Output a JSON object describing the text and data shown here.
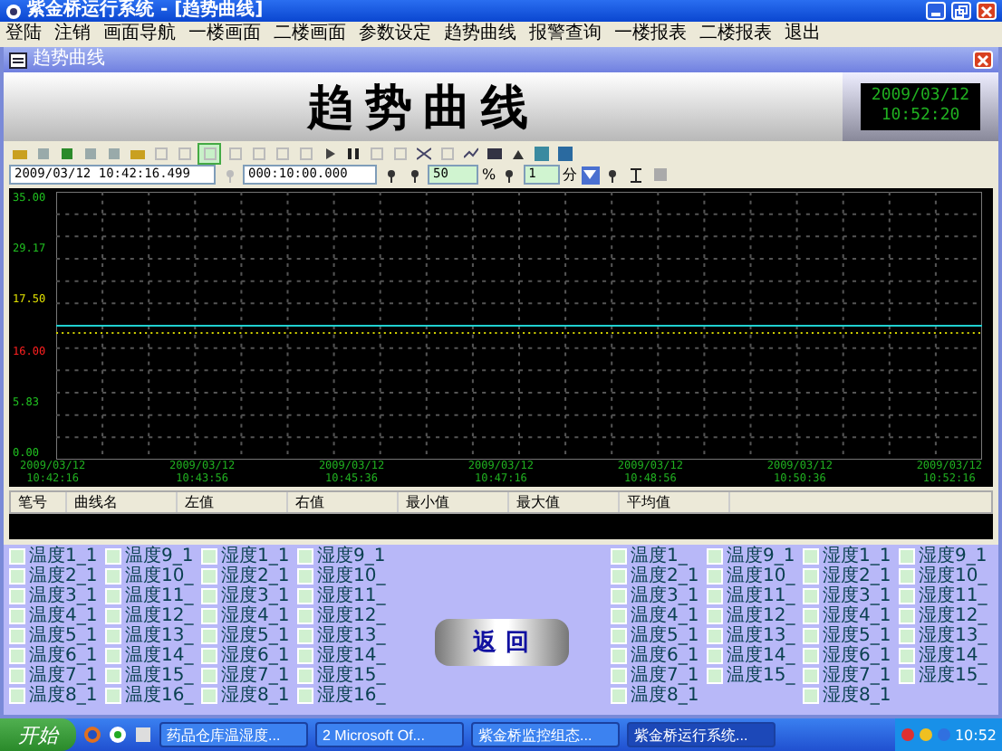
{
  "window": {
    "title": "紫金桥运行系统 - [趋势曲线]"
  },
  "menu": [
    "登陆",
    "注销",
    "画面导航",
    "一楼画面",
    "二楼画面",
    "参数设定",
    "趋势曲线",
    "报警查询",
    "一楼报表",
    "二楼报表",
    "退出"
  ],
  "child_window": {
    "title": "趋势曲线"
  },
  "header": {
    "title": "趋势曲线",
    "clock_date": "2009/03/12",
    "clock_time": "10:52:20"
  },
  "toolbar": {
    "start_time": "2009/03/12 10:42:16.499",
    "span": "000:10:00.000",
    "percent": "50",
    "percent_unit": "%",
    "step": "1",
    "step_unit": "分"
  },
  "chart": {
    "y_labels": [
      {
        "text": "35.00",
        "color": "#20c020"
      },
      {
        "text": "29.17",
        "color": "#20c020"
      },
      {
        "text": "17.50",
        "color": "#e0e000"
      },
      {
        "text": "16.00",
        "color": "#ff2020"
      },
      {
        "text": "5.83",
        "color": "#20c020"
      },
      {
        "text": "0.00",
        "color": "#20c020"
      }
    ],
    "x_labels": [
      {
        "date": "2009/03/12",
        "time": "10:42:16"
      },
      {
        "date": "2009/03/12",
        "time": "10:43:56"
      },
      {
        "date": "2009/03/12",
        "time": "10:45:36"
      },
      {
        "date": "2009/03/12",
        "time": "10:47:16"
      },
      {
        "date": "2009/03/12",
        "time": "10:48:56"
      },
      {
        "date": "2009/03/12",
        "time": "10:50:36"
      },
      {
        "date": "2009/03/12",
        "time": "10:52:16"
      }
    ]
  },
  "table": {
    "columns": [
      "笔号",
      "曲线名",
      "左值",
      "右值",
      "最小值",
      "最大值",
      "平均值"
    ]
  },
  "left_groups": [
    [
      {
        "label": "温度1_1",
        "checked": false
      },
      {
        "label": "温度2_1",
        "checked": false
      },
      {
        "label": "温度3_1",
        "checked": false
      },
      {
        "label": "温度4_1",
        "checked": false
      },
      {
        "label": "温度5_1",
        "checked": false
      },
      {
        "label": "温度6_1",
        "checked": false
      },
      {
        "label": "温度7_1",
        "checked": false
      },
      {
        "label": "温度8_1",
        "checked": false
      }
    ],
    [
      {
        "label": "温度9_1",
        "checked": false
      },
      {
        "label": "温度10_",
        "checked": false
      },
      {
        "label": "温度11_",
        "checked": false
      },
      {
        "label": "温度12_",
        "checked": false
      },
      {
        "label": "温度13_",
        "checked": false
      },
      {
        "label": "温度14_",
        "checked": false
      },
      {
        "label": "温度15_",
        "checked": false
      },
      {
        "label": "温度16_",
        "checked": false
      }
    ],
    [
      {
        "label": "湿度1_1",
        "checked": false
      },
      {
        "label": "湿度2_1",
        "checked": false
      },
      {
        "label": "湿度3_1",
        "checked": false
      },
      {
        "label": "湿度4_1",
        "checked": false
      },
      {
        "label": "湿度5_1",
        "checked": false
      },
      {
        "label": "湿度6_1",
        "checked": false
      },
      {
        "label": "湿度7_1",
        "checked": false
      },
      {
        "label": "湿度8_1",
        "checked": false
      }
    ],
    [
      {
        "label": "湿度9_1",
        "checked": false
      },
      {
        "label": "湿度10_",
        "checked": false
      },
      {
        "label": "湿度11_",
        "checked": false
      },
      {
        "label": "湿度12_",
        "checked": false
      },
      {
        "label": "湿度13_",
        "checked": false
      },
      {
        "label": "湿度14_",
        "checked": false
      },
      {
        "label": "湿度15_",
        "checked": false
      },
      {
        "label": "湿度16_",
        "checked": false
      }
    ]
  ],
  "right_groups": [
    [
      {
        "label": "温度1_",
        "checked": false
      },
      {
        "label": "温度2_1",
        "checked": false
      },
      {
        "label": "温度3_1",
        "checked": false
      },
      {
        "label": "温度4_1",
        "checked": false
      },
      {
        "label": "温度5_1",
        "checked": false
      },
      {
        "label": "温度6_1",
        "checked": false
      },
      {
        "label": "温度7_1",
        "checked": false
      },
      {
        "label": "温度8_1",
        "checked": false
      }
    ],
    [
      {
        "label": "温度9_1",
        "checked": false
      },
      {
        "label": "温度10_",
        "checked": false
      },
      {
        "label": "温度11_",
        "checked": false
      },
      {
        "label": "温度12_",
        "checked": false
      },
      {
        "label": "温度13_",
        "checked": false
      },
      {
        "label": "温度14_",
        "checked": false
      },
      {
        "label": "温度15_",
        "checked": false
      }
    ],
    [
      {
        "label": "湿度1_1",
        "checked": false
      },
      {
        "label": "湿度2_1",
        "checked": false
      },
      {
        "label": "湿度3_1",
        "checked": false
      },
      {
        "label": "湿度4_1",
        "checked": false
      },
      {
        "label": "湿度5_1",
        "checked": false
      },
      {
        "label": "湿度6_1",
        "checked": false
      },
      {
        "label": "湿度7_1",
        "checked": false
      },
      {
        "label": "湿度8_1",
        "checked": false
      }
    ],
    [
      {
        "label": "湿度9_1",
        "checked": false
      },
      {
        "label": "湿度10_",
        "checked": false
      },
      {
        "label": "湿度11_",
        "checked": false
      },
      {
        "label": "湿度12_",
        "checked": false
      },
      {
        "label": "湿度13_",
        "checked": false
      },
      {
        "label": "湿度14_",
        "checked": false
      },
      {
        "label": "湿度15_",
        "checked": false
      }
    ]
  ],
  "return_button": "返 回",
  "taskbar": {
    "start": "开始",
    "tasks": [
      {
        "label": "药品仓库温湿度...",
        "selected": false
      },
      {
        "label": "2 Microsoft Of...",
        "selected": false
      },
      {
        "label": "紫金桥监控组态...",
        "selected": false
      },
      {
        "label": "紫金桥运行系统...",
        "selected": true
      }
    ],
    "clock": "10:52"
  }
}
